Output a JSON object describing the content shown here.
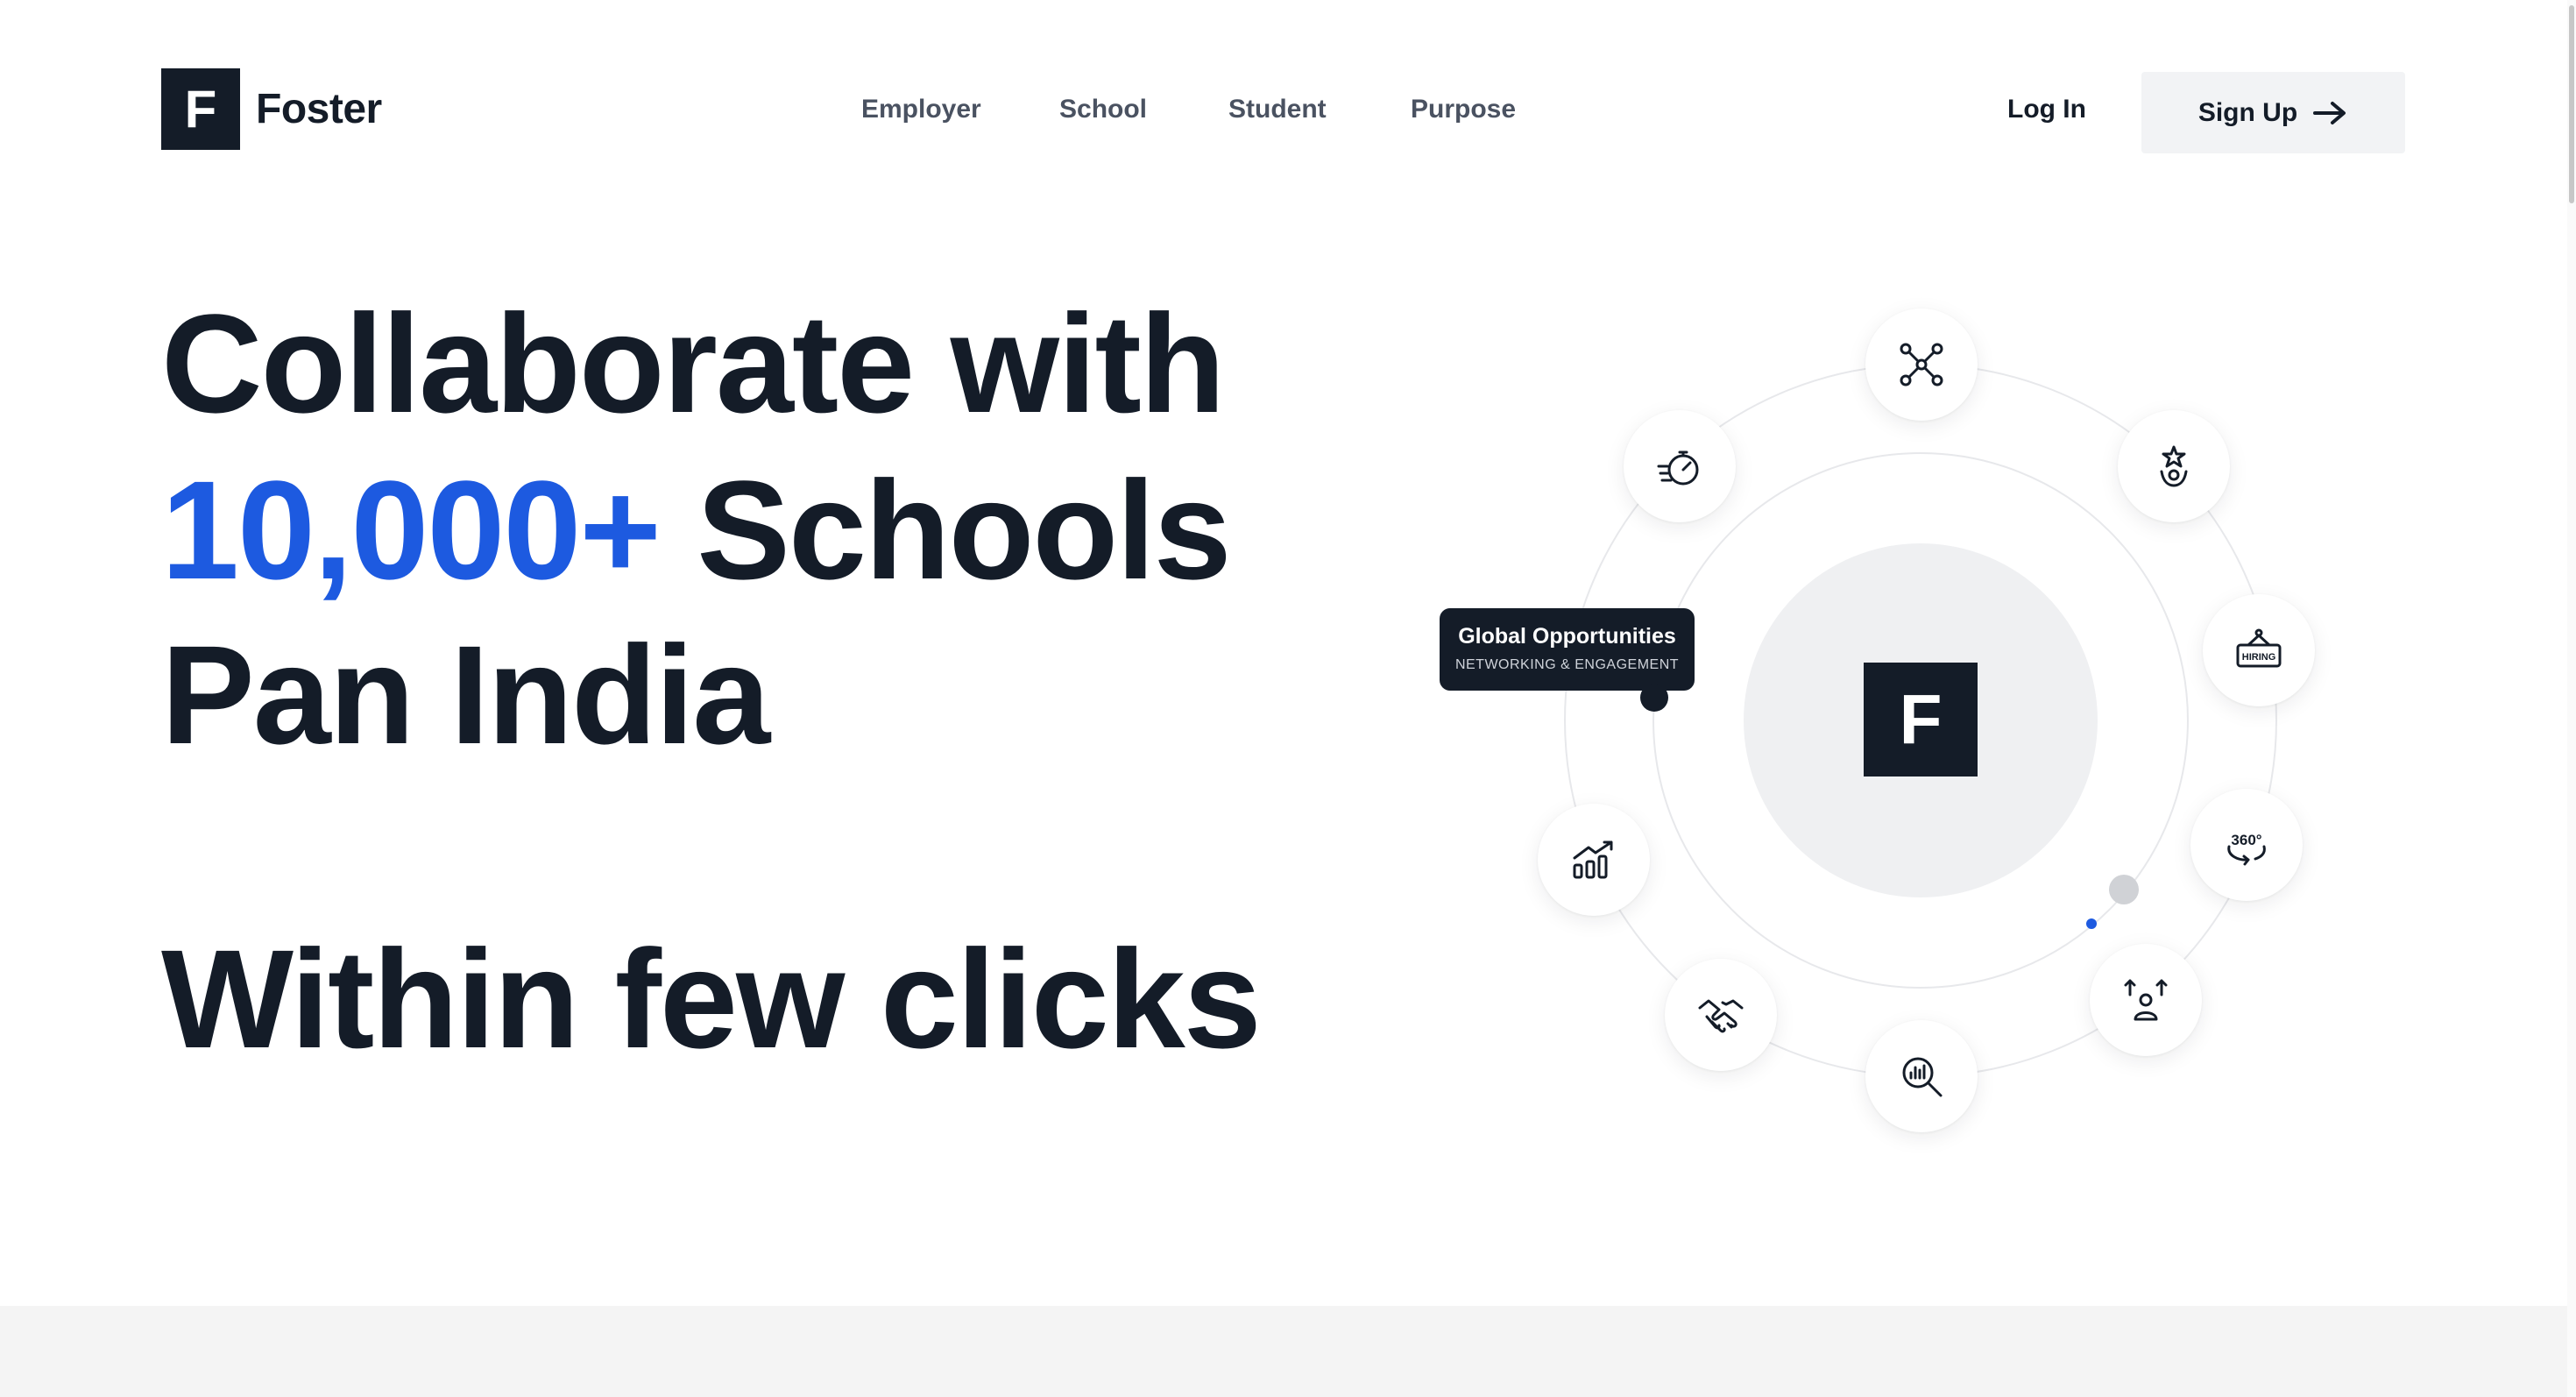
{
  "brand": {
    "logo_letter": "F",
    "name": "Foster"
  },
  "nav": {
    "items": [
      {
        "label": "Employer"
      },
      {
        "label": "School"
      },
      {
        "label": "Student"
      },
      {
        "label": "Purpose"
      }
    ],
    "login_label": "Log In",
    "signup_label": "Sign Up",
    "signup_icon": "arrow-right-icon"
  },
  "hero": {
    "line1": "Collaborate with",
    "highlight": "10,000+",
    "line2_rest": " Schools",
    "line3": "Pan India",
    "line4": "Within few clicks",
    "highlight_color": "#1d5ae0",
    "text_color": "#141c28"
  },
  "orbit": {
    "center_letter": "F",
    "tooltip": {
      "title": "Global Opportunities",
      "subtitle": "NETWORKING & ENGAGEMENT"
    },
    "nodes": [
      {
        "icon": "network-icon"
      },
      {
        "icon": "award-person-icon"
      },
      {
        "icon": "hiring-sign-icon",
        "label": "HIRING"
      },
      {
        "icon": "360-view-icon",
        "label": "360°"
      },
      {
        "icon": "people-growth-icon"
      },
      {
        "icon": "search-analytics-icon"
      },
      {
        "icon": "handshake-icon"
      },
      {
        "icon": "growth-chart-icon"
      },
      {
        "icon": "speed-timer-icon"
      }
    ]
  }
}
